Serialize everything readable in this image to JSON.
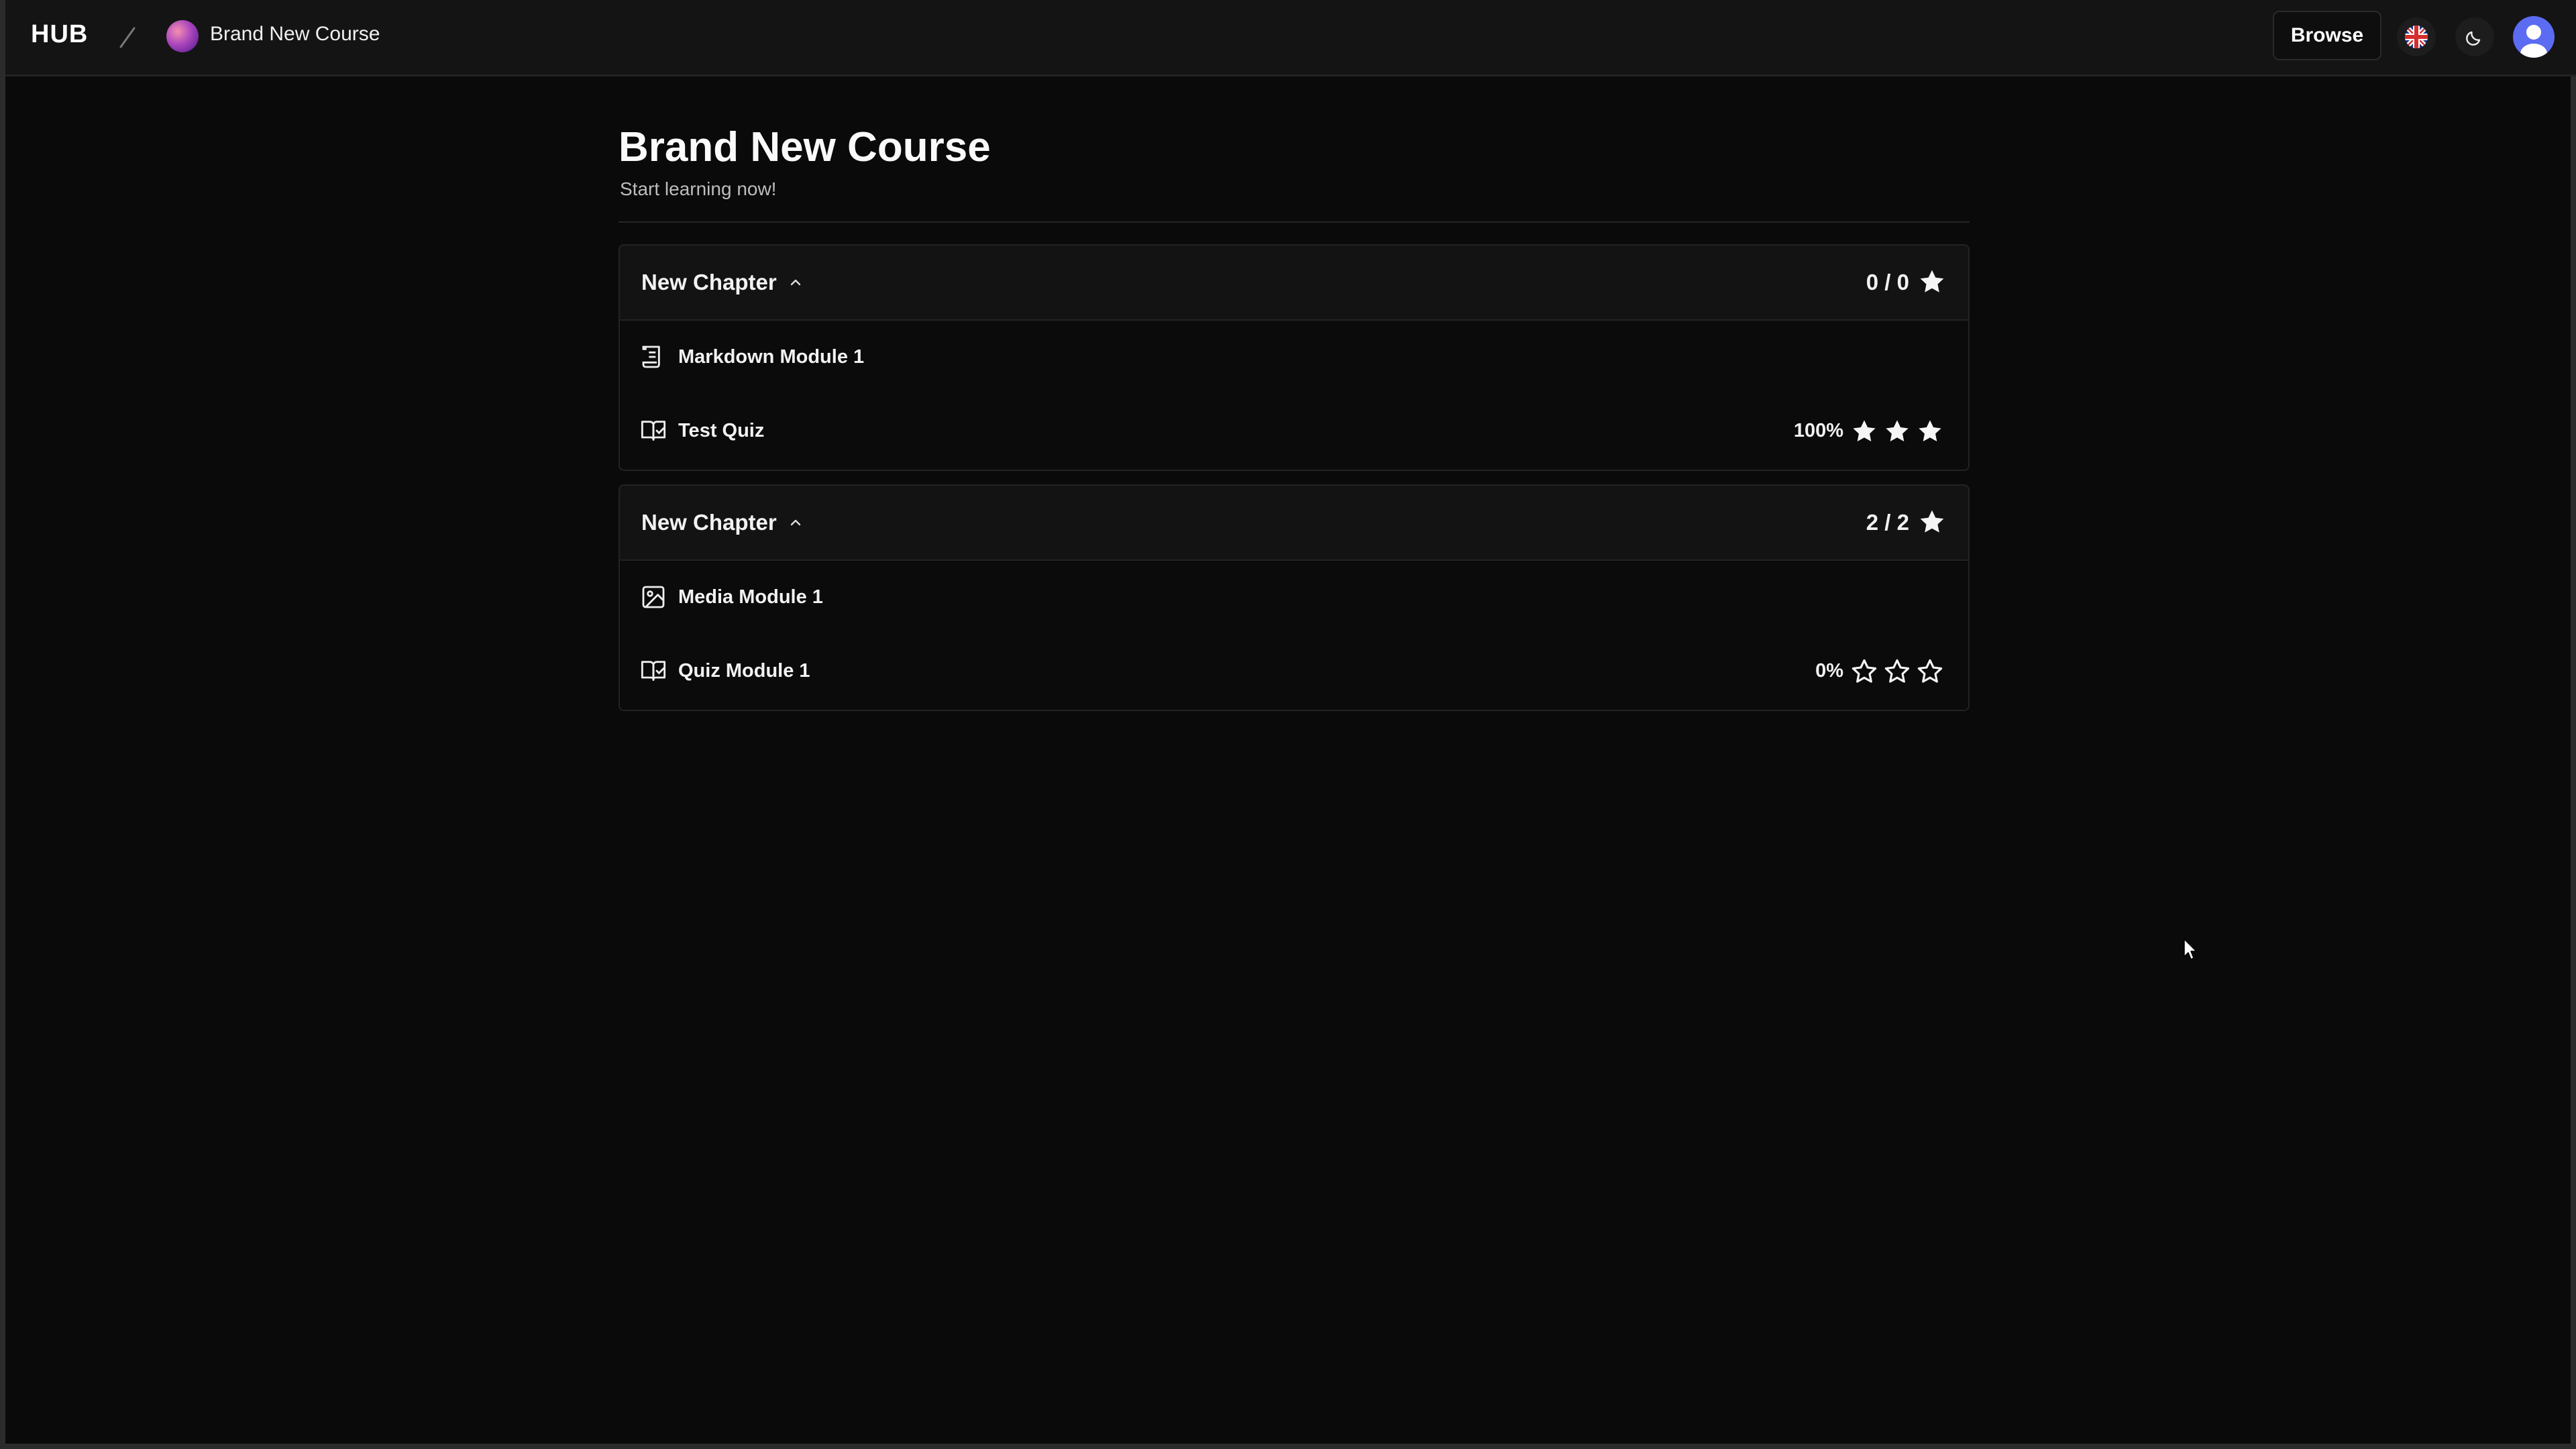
{
  "topbar": {
    "brand": "HUB",
    "breadcrumb_title": "Brand New Course",
    "browse_label": "Browse"
  },
  "page": {
    "title": "Brand New Course",
    "subtitle": "Start learning now!"
  },
  "chapters": [
    {
      "title": "New Chapter",
      "count": "0 / 0",
      "modules": [
        {
          "label": "Markdown Module 1",
          "icon": "markdown-icon",
          "score": ""
        },
        {
          "label": "Test Quiz",
          "icon": "quiz-book-icon",
          "score": "100%",
          "stars_filled": 3,
          "stars_total": 3
        }
      ]
    },
    {
      "title": "New Chapter",
      "count": "2 / 2",
      "modules": [
        {
          "label": "Media Module 1",
          "icon": "image-icon",
          "score": ""
        },
        {
          "label": "Quiz Module 1",
          "icon": "quiz-book-icon",
          "score": "0%",
          "stars_filled": 0,
          "stars_total": 3
        }
      ]
    }
  ],
  "colors": {
    "background": "#0a0a0a",
    "header_bg": "#131313",
    "text": "#f2f2f2",
    "user_avatar": "#5b6cf2"
  }
}
